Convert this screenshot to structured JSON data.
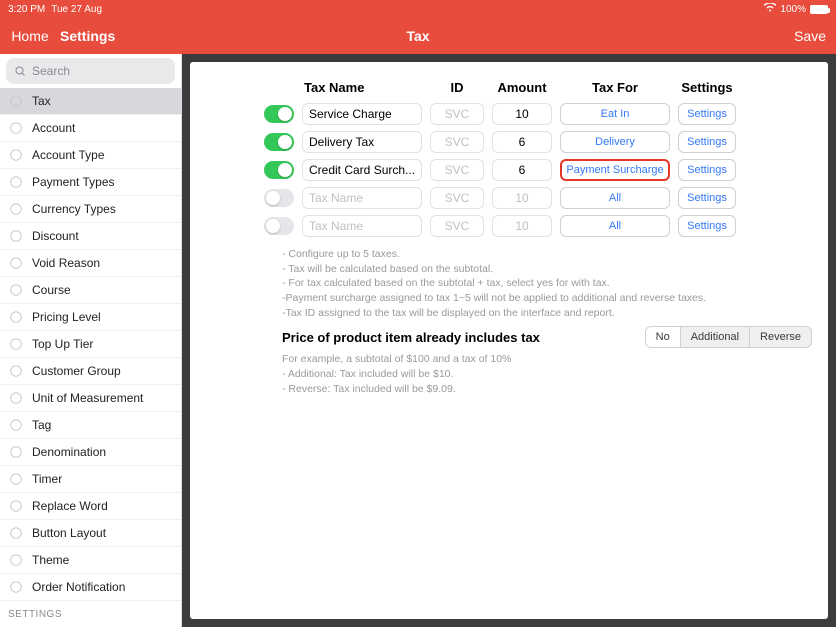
{
  "status": {
    "time": "3:20 PM",
    "date": "Tue 27 Aug",
    "battery_text": "100%"
  },
  "header": {
    "home": "Home",
    "settings": "Settings",
    "title": "Tax",
    "save": "Save"
  },
  "search": {
    "placeholder": "Search"
  },
  "sidebar": {
    "items": [
      {
        "label": "Tax",
        "active": true
      },
      {
        "label": "Account"
      },
      {
        "label": "Account Type"
      },
      {
        "label": "Payment Types"
      },
      {
        "label": "Currency Types"
      },
      {
        "label": "Discount"
      },
      {
        "label": "Void Reason"
      },
      {
        "label": "Course"
      },
      {
        "label": "Pricing Level"
      },
      {
        "label": "Top Up Tier"
      },
      {
        "label": "Customer Group"
      },
      {
        "label": "Unit of Measurement"
      },
      {
        "label": "Tag"
      },
      {
        "label": "Denomination"
      },
      {
        "label": "Timer"
      },
      {
        "label": "Replace Word"
      },
      {
        "label": "Button Layout"
      },
      {
        "label": "Theme"
      },
      {
        "label": "Order Notification"
      }
    ],
    "section": "SETTINGS"
  },
  "columns": {
    "tax_name": "Tax Name",
    "id": "ID",
    "amount": "Amount",
    "tax_for": "Tax For",
    "settings": "Settings"
  },
  "rows": [
    {
      "on": true,
      "name": "Service Charge",
      "id": "SVC",
      "amount": "10",
      "tax_for": "Eat In",
      "settings": "Settings",
      "highlight": false,
      "placeholder": false
    },
    {
      "on": true,
      "name": "Delivery Tax",
      "id": "SVC",
      "amount": "6",
      "tax_for": "Delivery",
      "settings": "Settings",
      "highlight": false,
      "placeholder": false
    },
    {
      "on": true,
      "name": "Credit Card Surch...",
      "id": "SVC",
      "amount": "6",
      "tax_for": "Payment Surcharge",
      "settings": "Settings",
      "highlight": true,
      "placeholder": false
    },
    {
      "on": false,
      "name": "Tax Name",
      "id": "SVC",
      "amount": "10",
      "tax_for": "All",
      "settings": "Settings",
      "highlight": false,
      "placeholder": true
    },
    {
      "on": false,
      "name": "Tax Name",
      "id": "SVC",
      "amount": "10",
      "tax_for": "All",
      "settings": "Settings",
      "highlight": false,
      "placeholder": true
    }
  ],
  "notes": [
    "- Configure up to 5 taxes.",
    "- Tax will be calculated based on the subtotal.",
    "- For tax calculated based on the subtotal + tax, select yes for with tax.",
    "-Payment surcharge assigned to tax 1~5 will not be applied to additional and reverse taxes.",
    "-Tax ID assigned to the tax will be displayed on the interface and report."
  ],
  "includes": {
    "label": "Price of product item already includes tax",
    "options": [
      "No",
      "Additional",
      "Reverse"
    ],
    "selected": "No"
  },
  "example": [
    "For example, a subtotal of $100 and a tax of 10%",
    "- Additional: Tax included will be $10.",
    "- Reverse: Tax included will be $9.09."
  ]
}
